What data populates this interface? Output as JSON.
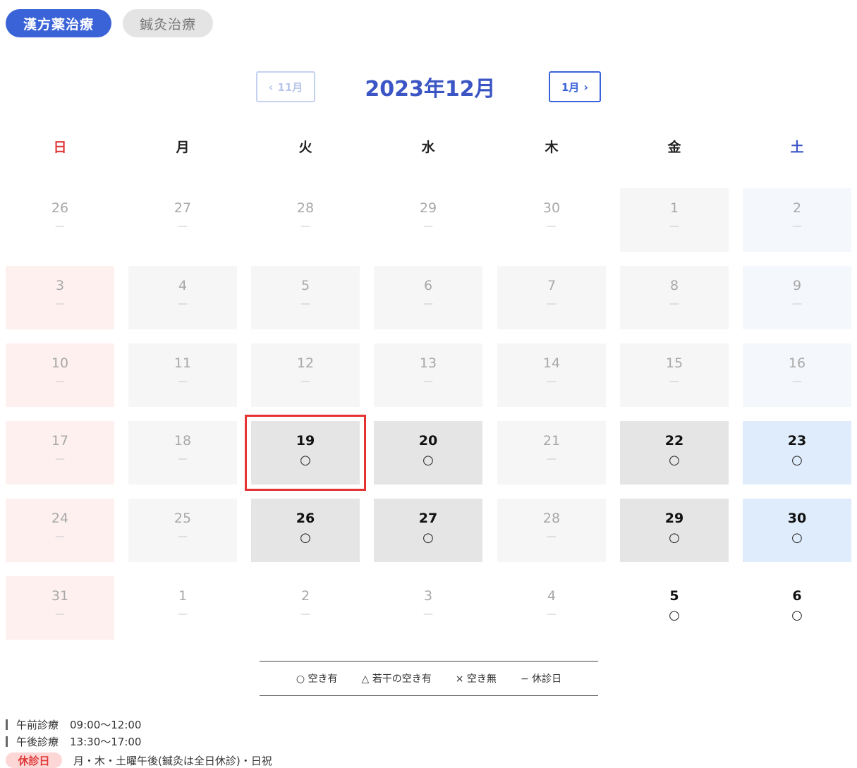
{
  "tabs": [
    {
      "label": "漢方薬治療",
      "active": true
    },
    {
      "label": "鍼灸治療",
      "active": false
    }
  ],
  "nav": {
    "prev_label": "11月",
    "next_label": "1月",
    "title": "2023年12月"
  },
  "weekdays": [
    "日",
    "月",
    "火",
    "水",
    "木",
    "金",
    "土"
  ],
  "weeks": [
    [
      {
        "day": "26",
        "mark": "—",
        "bg": "none",
        "available": false
      },
      {
        "day": "27",
        "mark": "—",
        "bg": "none",
        "available": false
      },
      {
        "day": "28",
        "mark": "—",
        "bg": "none",
        "available": false
      },
      {
        "day": "29",
        "mark": "—",
        "bg": "none",
        "available": false
      },
      {
        "day": "30",
        "mark": "—",
        "bg": "none",
        "available": false
      },
      {
        "day": "1",
        "mark": "—",
        "bg": "grey",
        "available": false
      },
      {
        "day": "2",
        "mark": "—",
        "bg": "blue",
        "available": false
      }
    ],
    [
      {
        "day": "3",
        "mark": "—",
        "bg": "pink",
        "available": false
      },
      {
        "day": "4",
        "mark": "—",
        "bg": "grey",
        "available": false
      },
      {
        "day": "5",
        "mark": "—",
        "bg": "grey",
        "available": false
      },
      {
        "day": "6",
        "mark": "—",
        "bg": "grey",
        "available": false
      },
      {
        "day": "7",
        "mark": "—",
        "bg": "grey",
        "available": false
      },
      {
        "day": "8",
        "mark": "—",
        "bg": "grey",
        "available": false
      },
      {
        "day": "9",
        "mark": "—",
        "bg": "blue",
        "available": false
      }
    ],
    [
      {
        "day": "10",
        "mark": "—",
        "bg": "pink",
        "available": false
      },
      {
        "day": "11",
        "mark": "—",
        "bg": "grey",
        "available": false
      },
      {
        "day": "12",
        "mark": "—",
        "bg": "grey",
        "available": false
      },
      {
        "day": "13",
        "mark": "—",
        "bg": "grey",
        "available": false
      },
      {
        "day": "14",
        "mark": "—",
        "bg": "grey",
        "available": false
      },
      {
        "day": "15",
        "mark": "—",
        "bg": "grey",
        "available": false
      },
      {
        "day": "16",
        "mark": "—",
        "bg": "blue",
        "available": false
      }
    ],
    [
      {
        "day": "17",
        "mark": "—",
        "bg": "pink",
        "available": false
      },
      {
        "day": "18",
        "mark": "—",
        "bg": "grey",
        "available": false
      },
      {
        "day": "19",
        "mark": "○",
        "bg": "avail",
        "available": true,
        "selected": true
      },
      {
        "day": "20",
        "mark": "○",
        "bg": "avail",
        "available": true
      },
      {
        "day": "21",
        "mark": "—",
        "bg": "grey",
        "available": false
      },
      {
        "day": "22",
        "mark": "○",
        "bg": "avail",
        "available": true
      },
      {
        "day": "23",
        "mark": "○",
        "bg": "availblue",
        "available": true
      }
    ],
    [
      {
        "day": "24",
        "mark": "—",
        "bg": "pink",
        "available": false
      },
      {
        "day": "25",
        "mark": "—",
        "bg": "grey",
        "available": false
      },
      {
        "day": "26",
        "mark": "○",
        "bg": "avail",
        "available": true
      },
      {
        "day": "27",
        "mark": "○",
        "bg": "avail",
        "available": true
      },
      {
        "day": "28",
        "mark": "—",
        "bg": "grey",
        "available": false
      },
      {
        "day": "29",
        "mark": "○",
        "bg": "avail",
        "available": true
      },
      {
        "day": "30",
        "mark": "○",
        "bg": "availblue",
        "available": true
      }
    ],
    [
      {
        "day": "31",
        "mark": "—",
        "bg": "pink",
        "available": false
      },
      {
        "day": "1",
        "mark": "—",
        "bg": "none",
        "available": false
      },
      {
        "day": "2",
        "mark": "—",
        "bg": "none",
        "available": false
      },
      {
        "day": "3",
        "mark": "—",
        "bg": "none",
        "available": false
      },
      {
        "day": "4",
        "mark": "—",
        "bg": "none",
        "available": false
      },
      {
        "day": "5",
        "mark": "○",
        "bg": "none",
        "available": true
      },
      {
        "day": "6",
        "mark": "○",
        "bg": "none",
        "available": true
      }
    ]
  ],
  "legend": [
    "○ 空き有",
    "△ 若干の空き有",
    "× 空き無",
    "− 休診日"
  ],
  "info": {
    "morning_label": "午前診療",
    "morning_time": "09:00〜12:00",
    "afternoon_label": "午後診療",
    "afternoon_time": "13:30〜17:00",
    "closed_label": "休診日",
    "closed_text": "月・木・土曜午後(鍼灸は全日休診)・日祝"
  },
  "colors": {
    "accent": "#3b63d8",
    "title": "#3b55c4",
    "sunday": "#e03b3b",
    "saturday": "#3b55c4",
    "selected_outline": "#e53232"
  }
}
